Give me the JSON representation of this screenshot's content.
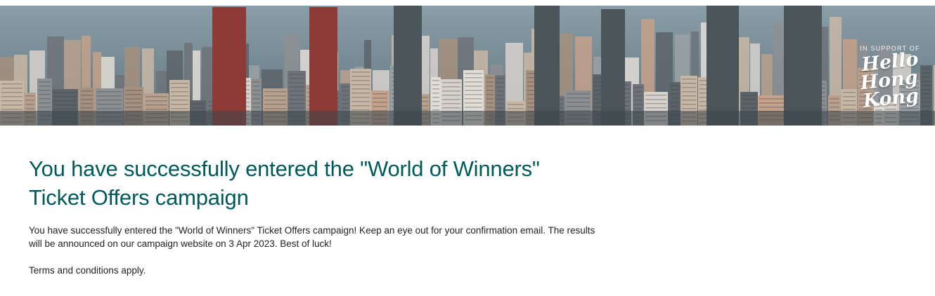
{
  "hero": {
    "badge": {
      "support_text": "IN SUPPORT OF",
      "logo_line1": "Hello",
      "logo_line2": "Hong Kong"
    },
    "colors": {
      "water": "#6f8793",
      "sky_haze": "#8ea1ab"
    }
  },
  "main": {
    "heading_line1": "You have successfully entered the \"World of Winners\"",
    "heading_line2": "Ticket Offers campaign",
    "body": "You have successfully entered the \"World of Winners\" Ticket Offers campaign! Keep an eye out for your confirmation email. The results will be announced on our campaign website on 3 Apr 2023. Best of luck!",
    "terms": "Terms and conditions apply."
  },
  "colors": {
    "heading": "#005a5b",
    "text": "#222222"
  }
}
